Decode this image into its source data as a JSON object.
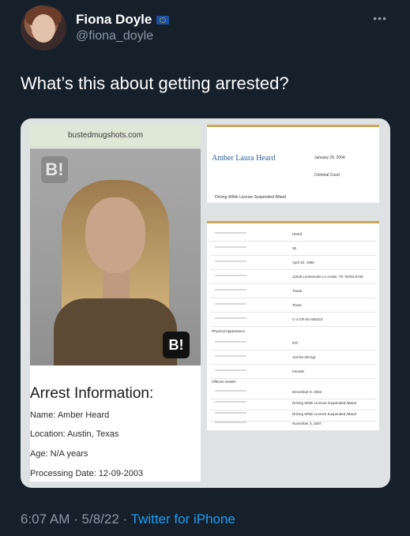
{
  "tweet": {
    "display_name": "Fiona Doyle",
    "handle": "@fiona_doyle",
    "text": "What’s this about getting arrested?",
    "time": "6:07 AM",
    "date": "5/8/22",
    "source": "Twitter for iPhone",
    "separator": "·"
  },
  "icons": {
    "verified_flag": "eu-flag-icon",
    "more": "more-options-icon"
  },
  "media": {
    "site": "bustedmugshots.com",
    "badge_text": "B!",
    "arrest_title": "Arrest Information:",
    "name_line": "Name: Amber Heard",
    "location_line": "Location: Austin, Texas",
    "age_line": "Age: N/A years",
    "processing_line": "Processing Date: 12-09-2003",
    "record": {
      "full_name": "Amber Laura Heard",
      "date": "January 29, 2004",
      "court": "Criminal Court",
      "charge": "Driving While License Suspended /Mand",
      "rows": [
        "Heard",
        "36",
        "April 22, 1986",
        "11618 Lonesmoke Ln Austin, TX 78754-5736",
        "Travis",
        "Texas",
        "C-1-CR-04-456223",
        "5'8\"",
        "110 lbs (50 kg)",
        "Female",
        "December 9, 2003",
        "Driving While License Suspended /Mand",
        "Driving While License Suspended /Mand",
        "November 3, 2007"
      ],
      "physical_label": "Physical Appearance",
      "offense_label": "Offense Details"
    }
  },
  "colors": {
    "background": "#15202b",
    "secondary_text": "#8b98a5",
    "link": "#1d9bf0"
  }
}
